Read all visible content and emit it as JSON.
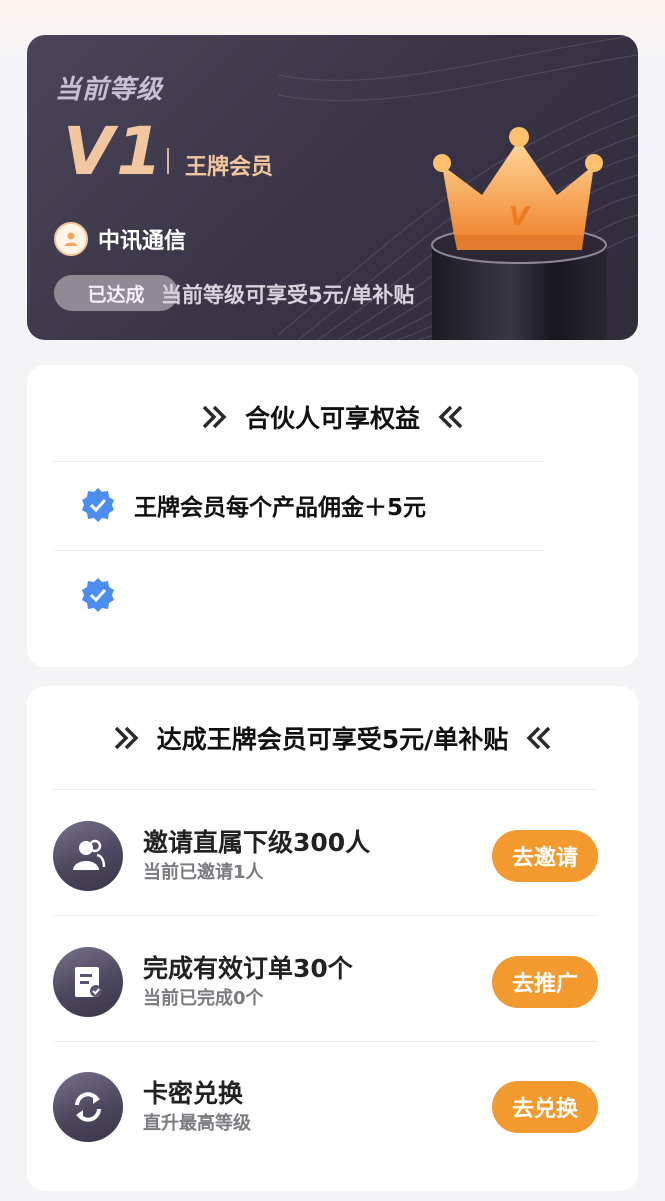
{
  "hero": {
    "title": "当前等级",
    "level": "V1",
    "tier": "王牌会员",
    "company": "中讯通信",
    "badge": "已达成",
    "perk": "当前等级可享受5元/单补贴",
    "crown_letter": "V"
  },
  "benefits": {
    "title": "合伙人可享权益",
    "items": [
      {
        "text": "王牌会员每个产品佣金＋5元",
        "icon": "verified-badge-icon"
      },
      {
        "text": "",
        "icon": "verified-badge-icon"
      }
    ]
  },
  "tasks": {
    "title": "达成王牌会员可享受5元/单补贴",
    "items": [
      {
        "title": "邀请直属下级300人",
        "sub": "当前已邀请1人",
        "button": "去邀请",
        "icon": "users-icon"
      },
      {
        "title": "完成有效订单30个",
        "sub": "当前已完成0个",
        "button": "去推广",
        "icon": "order-document-icon"
      },
      {
        "title": "卡密兑换",
        "sub": "直升最高等级",
        "button": "去兑换",
        "icon": "exchange-icon"
      }
    ]
  },
  "colors": {
    "accent": "#f29a2e",
    "hero_bg": "#3b3648",
    "level_gold": "#f2c7a0",
    "verified_blue": "#4b8ef0"
  }
}
